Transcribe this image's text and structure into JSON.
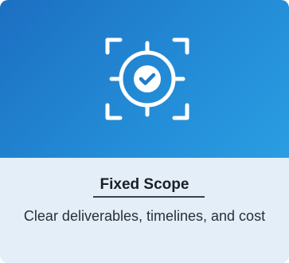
{
  "card": {
    "icon": "target-check-icon",
    "title": "Fixed Scope",
    "description": "Clear deliverables, timelines, and cost"
  },
  "colors": {
    "hero_start": "#1c6fc2",
    "hero_end": "#2a9de2",
    "body_background": "#e3eef8",
    "title_text": "#1b1f24",
    "icon_stroke": "#ffffff"
  }
}
